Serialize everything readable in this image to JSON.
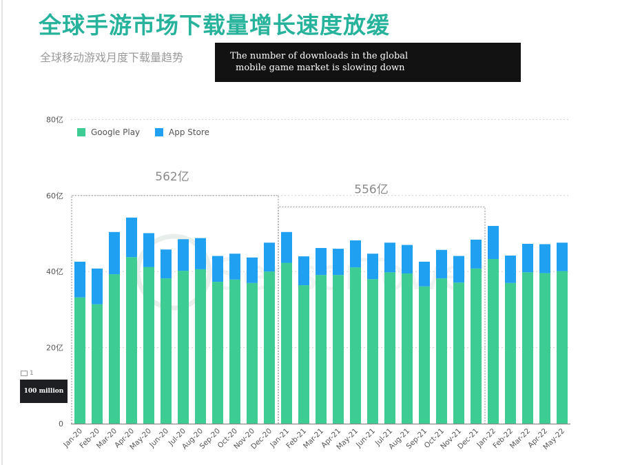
{
  "header": {
    "title": "全球手游市场下载量增长速度放缓",
    "subtitle": "全球移动游戏月度下载量趋势",
    "translation_line1": "The number of downloads in the global",
    "translation_line2": "mobile game market is slowing down"
  },
  "unit_note": {
    "marker": "1",
    "label": "100 million"
  },
  "colors": {
    "title": "#27b39b",
    "google_play": "#3dcc94",
    "app_store": "#1fa0f0"
  },
  "chart_data": {
    "type": "bar",
    "stacked": true,
    "title": "全球移动游戏月度下载量趋势",
    "xlabel": "",
    "ylabel": "",
    "ylim": [
      0,
      80
    ],
    "yticks": [
      0,
      20,
      40,
      60,
      80
    ],
    "ytick_labels": [
      "0",
      "20亿",
      "40亿",
      "60亿",
      "80亿"
    ],
    "grid": true,
    "legend_position": "top-left",
    "categories": [
      "Jan-20",
      "Feb-20",
      "Mar-20",
      "Apr-20",
      "May-20",
      "Jun-20",
      "Jul-20",
      "Aug-20",
      "Sep-20",
      "Oct-20",
      "Nov-20",
      "Dec-20",
      "Jan-21",
      "Feb-21",
      "Mar-21",
      "Apr-21",
      "May-21",
      "Jun-21",
      "Jul-21",
      "Aug-21",
      "Sep-21",
      "Oct-21",
      "Nov-21",
      "Dec-21",
      "Jan-22",
      "Feb-22",
      "Mar-22",
      "Apr-22",
      "May-22"
    ],
    "series": [
      {
        "name": "Google Play",
        "color": "#3dcc94",
        "values": [
          33.2,
          31.4,
          39.3,
          43.8,
          41.2,
          38.2,
          40.2,
          40.6,
          37.3,
          37.9,
          37.0,
          40.0,
          42.3,
          36.4,
          39.1,
          39.1,
          41.1,
          38.0,
          39.8,
          39.5,
          36.1,
          38.2,
          37.1,
          40.8,
          43.3,
          37.0,
          39.8,
          39.6,
          40.1
        ]
      },
      {
        "name": "App Store",
        "color": "#1fa0f0",
        "values": [
          9.4,
          9.4,
          11.1,
          10.4,
          8.9,
          7.6,
          8.3,
          8.2,
          6.8,
          6.8,
          6.7,
          7.6,
          8.1,
          7.6,
          7.1,
          6.9,
          7.1,
          6.7,
          7.8,
          7.5,
          6.5,
          7.5,
          7.0,
          7.6,
          8.7,
          7.2,
          7.5,
          7.6,
          7.5
        ]
      }
    ],
    "annotations": [
      {
        "label": "562亿",
        "from": "Jan-20",
        "to": "Dec-20",
        "level": 60
      },
      {
        "label": "556亿",
        "from": "Jan-21",
        "to": "Dec-21",
        "level": 57
      }
    ],
    "watermark": "SensorTower"
  }
}
